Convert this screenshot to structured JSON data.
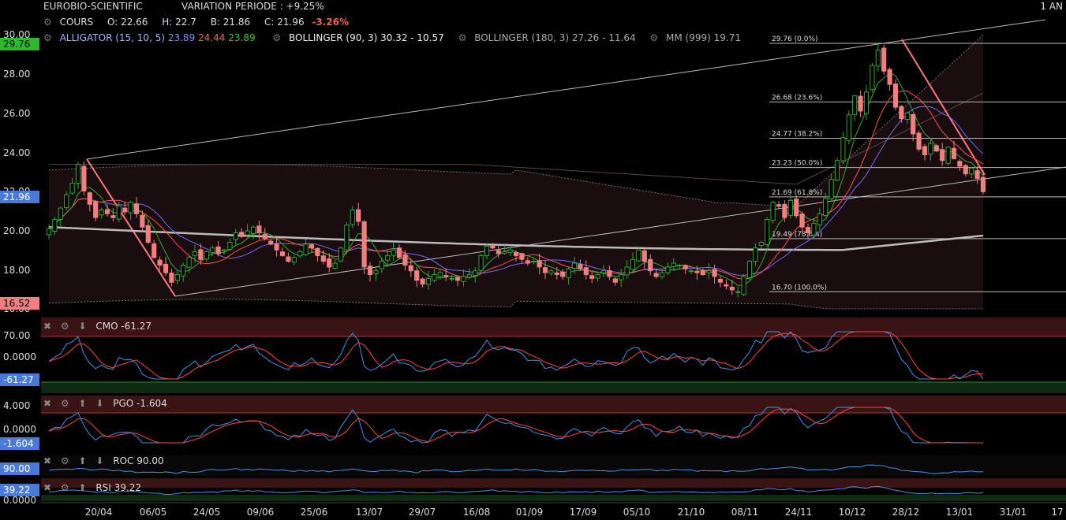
{
  "header": {
    "instrument": "EUROBIO-SCIENTIFIC",
    "variation_label": "VARIATION PERIODE : +9.25%",
    "period": "1 AN"
  },
  "legend_line1": {
    "cours_label": "COURS",
    "open": "O: 22.66",
    "high": "H: 22.7",
    "low": "B: 21.86",
    "close": "C: 21.96",
    "change": "-3.26%"
  },
  "legend_line2": {
    "alligator_label": "ALLIGATOR (15, 10, 5)",
    "alligator_v1": "23.89",
    "alligator_v2": "24.44",
    "alligator_v3": "23.89",
    "bollinger1": "BOLLINGER (90, 3) 30.32 - 10.57",
    "bollinger2": "BOLLINGER (180, 3) 27.26 - 11.64",
    "mm": "MM (999) 19.71"
  },
  "colors": {
    "candle_up": "#2ea82e",
    "candle_down": "#f08080",
    "alligator_blue": "#6e6ef5",
    "alligator_red": "#ff5050",
    "alligator_green": "#33aa33",
    "indicator_blue": "#4a90e2",
    "indicator_red": "#ff4444",
    "badge_green": "#2db82d",
    "badge_blue": "#4a7ad8",
    "badge_red": "#f08080"
  },
  "chart_data": [
    {
      "type": "candlestick",
      "title": "EUROBIO-SCIENTIFIC",
      "y_ticks": [
        "30.00",
        "28.00",
        "26.00",
        "24.00",
        "22.00",
        "20.00",
        "18.00",
        "16.00"
      ],
      "ylim": [
        15.8,
        30.3
      ],
      "x_ticks": [
        "20/04",
        "06/05",
        "24/05",
        "09/06",
        "25/06",
        "13/07",
        "29/07",
        "16/08",
        "01/09",
        "17/09",
        "05/10",
        "21/10",
        "08/11",
        "24/11",
        "10/12",
        "28/12",
        "13/01",
        "31/01",
        "17"
      ],
      "price_badges": {
        "high": "29.76",
        "last": "21.96",
        "low": "16.52"
      },
      "close_series": [
        20.0,
        20.5,
        21.1,
        21.8,
        22.4,
        23.4,
        22.0,
        21.3,
        20.6,
        21.0,
        20.8,
        20.6,
        21.2,
        20.9,
        21.4,
        20.8,
        20.1,
        19.3,
        18.5,
        18.1,
        17.7,
        17.2,
        17.6,
        18.1,
        18.5,
        18.8,
        18.4,
        18.8,
        19.0,
        18.7,
        18.9,
        19.3,
        19.8,
        19.6,
        19.9,
        20.1,
        19.8,
        19.5,
        19.2,
        18.9,
        18.6,
        18.3,
        18.5,
        18.8,
        19.2,
        19.0,
        18.6,
        18.3,
        18.0,
        18.2,
        19.0,
        20.2,
        21.0,
        20.4,
        18.0,
        17.6,
        17.8,
        18.3,
        18.6,
        18.9,
        18.5,
        18.1,
        17.8,
        17.3,
        17.1,
        17.4,
        17.6,
        17.7,
        17.5,
        17.4,
        17.3,
        17.5,
        17.6,
        17.8,
        18.6,
        19.1,
        19.0,
        18.7,
        18.8,
        18.9,
        18.6,
        18.4,
        18.2,
        18.3,
        18.0,
        17.7,
        17.8,
        17.6,
        17.5,
        17.9,
        18.2,
        17.9,
        17.6,
        17.4,
        17.6,
        17.8,
        17.5,
        17.2,
        17.6,
        18.0,
        18.4,
        18.9,
        18.3,
        17.8,
        17.5,
        17.7,
        18.0,
        18.2,
        18.1,
        17.9,
        17.8,
        17.7,
        17.6,
        17.8,
        17.5,
        17.2,
        17.0,
        16.8,
        16.7,
        17.5,
        18.3,
        19.0,
        19.3,
        20.5,
        21.4,
        21.2,
        20.6,
        21.5,
        20.7,
        20.1,
        19.8,
        20.3,
        20.8,
        21.6,
        22.6,
        23.6,
        24.8,
        26.0,
        27.0,
        26.2,
        27.2,
        28.6,
        29.4,
        28.3,
        27.6,
        26.4,
        25.8,
        26.1,
        25.0,
        24.2,
        23.9,
        24.5,
        24.1,
        23.6,
        24.3,
        23.7,
        23.3,
        22.9,
        23.2,
        22.66,
        21.96
      ],
      "fibonacci": [
        {
          "label": "29.76  (0.0%)",
          "value": 29.76
        },
        {
          "label": "26.68  (23.6%)",
          "value": 26.68
        },
        {
          "label": "24.77  (38.2%)",
          "value": 24.77
        },
        {
          "label": "23.23  (50.0%)",
          "value": 23.23
        },
        {
          "label": "21.69  (61.8%)",
          "value": 21.69
        },
        {
          "label": "19.49  (78.6%)",
          "value": 19.49
        },
        {
          "label": "16.70  (100.0%)",
          "value": 16.7
        }
      ]
    },
    {
      "type": "line",
      "title": "CMO -61.27",
      "y_ticks": [
        "70.00",
        "0.0000"
      ],
      "value_badge": "-61.27",
      "series": [
        {
          "name": "CMO"
        },
        {
          "name": "signal"
        }
      ]
    },
    {
      "type": "line",
      "title": "PGO -1.604",
      "y_ticks": [
        "4.000",
        "0.0000"
      ],
      "value_badge": "-1.604",
      "series": [
        {
          "name": "PGO"
        },
        {
          "name": "signal"
        }
      ]
    },
    {
      "type": "line",
      "title": "ROC 90.00",
      "value_badge": "90.00"
    },
    {
      "type": "line",
      "title": "RSI 39.22",
      "y_ticks": [
        "0.0000"
      ],
      "value_badge": "39.22"
    }
  ]
}
